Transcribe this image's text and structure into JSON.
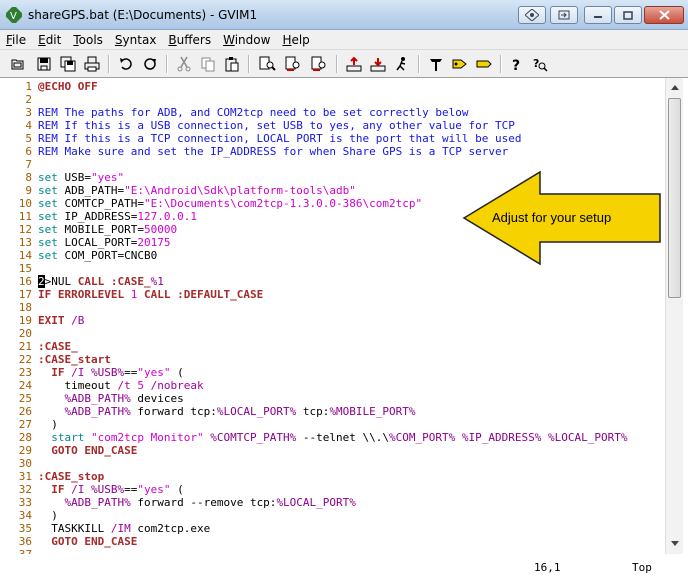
{
  "window": {
    "title": "shareGPS.bat (E:\\Documents) - GVIM1"
  },
  "menu": [
    "File",
    "Edit",
    "Tools",
    "Syntax",
    "Buffers",
    "Window",
    "Help"
  ],
  "toolbar_icons": [
    "open-icon",
    "save-icon",
    "save-all-icon",
    "print-icon",
    "undo-icon",
    "redo-icon",
    "cut-icon",
    "copy-icon",
    "paste-icon",
    "find-replace-icon",
    "find-next-icon",
    "find-prev-icon",
    "load-session-icon",
    "save-session-icon",
    "run-script-icon",
    "make-icon",
    "tag-icon",
    "jump-back-icon",
    "help-icon",
    "find-help-icon"
  ],
  "lines": [
    {
      "n": "1",
      "tokens": [
        {
          "t": "@ECHO",
          "c": "kw"
        },
        {
          "t": " "
        },
        {
          "t": "OFF",
          "c": "kw"
        }
      ]
    },
    {
      "n": "2",
      "tokens": []
    },
    {
      "n": "3",
      "tokens": [
        {
          "t": "REM The paths for ADB, and COM2tcp need to be set correctly below",
          "c": "cm"
        }
      ]
    },
    {
      "n": "4",
      "tokens": [
        {
          "t": "REM If this is a USB connection, set USB to yes, any other value for TCP",
          "c": "cm"
        }
      ]
    },
    {
      "n": "5",
      "tokens": [
        {
          "t": "REM If this is a TCP connection, LOCAL PORT is the port that will be used",
          "c": "cm"
        }
      ]
    },
    {
      "n": "6",
      "tokens": [
        {
          "t": "REM Make sure and set the IP_ADDRESS for when Share GPS is a TCP server",
          "c": "cm"
        }
      ]
    },
    {
      "n": "7",
      "tokens": []
    },
    {
      "n": "8",
      "tokens": [
        {
          "t": "set ",
          "c": "vr"
        },
        {
          "t": "USB="
        },
        {
          "t": "\"yes\"",
          "c": "st"
        }
      ]
    },
    {
      "n": "9",
      "tokens": [
        {
          "t": "set ",
          "c": "vr"
        },
        {
          "t": "ADB_PATH="
        },
        {
          "t": "\"E:\\Android\\Sdk\\platform-tools\\adb\"",
          "c": "st"
        }
      ]
    },
    {
      "n": "10",
      "tokens": [
        {
          "t": "set ",
          "c": "vr"
        },
        {
          "t": "COMTCP_PATH="
        },
        {
          "t": "\"E:\\Documents\\com2tcp-1.3.0.0-386\\com2tcp\"",
          "c": "st"
        }
      ]
    },
    {
      "n": "11",
      "tokens": [
        {
          "t": "set ",
          "c": "vr"
        },
        {
          "t": "IP_ADDRESS="
        },
        {
          "t": "127.0.0.1",
          "c": "nm"
        }
      ]
    },
    {
      "n": "12",
      "tokens": [
        {
          "t": "set ",
          "c": "vr"
        },
        {
          "t": "MOBILE_PORT="
        },
        {
          "t": "50000",
          "c": "nm"
        }
      ]
    },
    {
      "n": "13",
      "tokens": [
        {
          "t": "set ",
          "c": "vr"
        },
        {
          "t": "LOCAL_PORT="
        },
        {
          "t": "20175",
          "c": "nm"
        }
      ]
    },
    {
      "n": "14",
      "tokens": [
        {
          "t": "set ",
          "c": "vr"
        },
        {
          "t": "COM_PORT=CNCB0"
        }
      ]
    },
    {
      "n": "15",
      "tokens": []
    },
    {
      "n": "16",
      "tokens": [
        {
          "t": "2",
          "c": "cursor"
        },
        {
          "t": ">NUL "
        },
        {
          "t": "CALL",
          "c": "kw"
        },
        {
          "t": " "
        },
        {
          "t": ":CASE_",
          "c": "kw"
        },
        {
          "t": "%1",
          "c": "hl"
        }
      ]
    },
    {
      "n": "17",
      "tokens": [
        {
          "t": "IF ERRORLEVEL",
          "c": "kw"
        },
        {
          "t": " "
        },
        {
          "t": "1",
          "c": "nm"
        },
        {
          "t": " "
        },
        {
          "t": "CALL",
          "c": "kw"
        },
        {
          "t": " "
        },
        {
          "t": ":DEFAULT_CASE",
          "c": "kw"
        }
      ]
    },
    {
      "n": "18",
      "tokens": []
    },
    {
      "n": "19",
      "tokens": [
        {
          "t": "EXIT",
          "c": "kw"
        },
        {
          "t": " "
        },
        {
          "t": "/B",
          "c": "op"
        }
      ]
    },
    {
      "n": "20",
      "tokens": []
    },
    {
      "n": "21",
      "tokens": [
        {
          "t": ":CASE_",
          "c": "kw"
        }
      ]
    },
    {
      "n": "22",
      "tokens": [
        {
          "t": ":CASE_start",
          "c": "kw"
        }
      ]
    },
    {
      "n": "23",
      "tokens": [
        {
          "t": "  "
        },
        {
          "t": "IF",
          "c": "kw"
        },
        {
          "t": " "
        },
        {
          "t": "/I",
          "c": "op"
        },
        {
          "t": " "
        },
        {
          "t": "%USB%",
          "c": "hl"
        },
        {
          "t": "=="
        },
        {
          "t": "\"yes\"",
          "c": "st"
        },
        {
          "t": " ("
        }
      ]
    },
    {
      "n": "24",
      "tokens": [
        {
          "t": "    timeout "
        },
        {
          "t": "/t",
          "c": "op"
        },
        {
          "t": " "
        },
        {
          "t": "5",
          "c": "nm"
        },
        {
          "t": " "
        },
        {
          "t": "/nobreak",
          "c": "op"
        }
      ]
    },
    {
      "n": "25",
      "tokens": [
        {
          "t": "    "
        },
        {
          "t": "%ADB_PATH%",
          "c": "hl"
        },
        {
          "t": " devices"
        }
      ]
    },
    {
      "n": "26",
      "tokens": [
        {
          "t": "    "
        },
        {
          "t": "%ADB_PATH%",
          "c": "hl"
        },
        {
          "t": " forward tcp:"
        },
        {
          "t": "%LOCAL_PORT%",
          "c": "hl"
        },
        {
          "t": " tcp:"
        },
        {
          "t": "%MOBILE_PORT%",
          "c": "hl"
        }
      ]
    },
    {
      "n": "27",
      "tokens": [
        {
          "t": "  )"
        }
      ]
    },
    {
      "n": "28",
      "tokens": [
        {
          "t": "  start ",
          "c": "vr"
        },
        {
          "t": "\"com2tcp Monitor\"",
          "c": "st"
        },
        {
          "t": " "
        },
        {
          "t": "%COMTCP_PATH%",
          "c": "hl"
        },
        {
          "t": " --telnet \\\\.\\"
        },
        {
          "t": "%COM_PORT%",
          "c": "hl"
        },
        {
          "t": " "
        },
        {
          "t": "%IP_ADDRESS%",
          "c": "hl"
        },
        {
          "t": " "
        },
        {
          "t": "%LOCAL_PORT%",
          "c": "hl"
        }
      ]
    },
    {
      "n": "29",
      "tokens": [
        {
          "t": "  "
        },
        {
          "t": "GOTO",
          "c": "kw"
        },
        {
          "t": " "
        },
        {
          "t": "END_CASE",
          "c": "kw"
        }
      ]
    },
    {
      "n": "30",
      "tokens": []
    },
    {
      "n": "31",
      "tokens": [
        {
          "t": ":CASE_stop",
          "c": "kw"
        }
      ]
    },
    {
      "n": "32",
      "tokens": [
        {
          "t": "  "
        },
        {
          "t": "IF",
          "c": "kw"
        },
        {
          "t": " "
        },
        {
          "t": "/I",
          "c": "op"
        },
        {
          "t": " "
        },
        {
          "t": "%USB%",
          "c": "hl"
        },
        {
          "t": "=="
        },
        {
          "t": "\"yes\"",
          "c": "st"
        },
        {
          "t": " ("
        }
      ]
    },
    {
      "n": "33",
      "tokens": [
        {
          "t": "    "
        },
        {
          "t": "%ADB_PATH%",
          "c": "hl"
        },
        {
          "t": " forward --remove tcp:"
        },
        {
          "t": "%LOCAL_PORT%",
          "c": "hl"
        }
      ]
    },
    {
      "n": "34",
      "tokens": [
        {
          "t": "  )"
        }
      ]
    },
    {
      "n": "35",
      "tokens": [
        {
          "t": "  TASKKILL "
        },
        {
          "t": "/IM",
          "c": "op"
        },
        {
          "t": " com2tcp.exe"
        }
      ]
    },
    {
      "n": "36",
      "tokens": [
        {
          "t": "  "
        },
        {
          "t": "GOTO",
          "c": "kw"
        },
        {
          "t": " "
        },
        {
          "t": "END_CASE",
          "c": "kw"
        }
      ]
    },
    {
      "n": "37",
      "tokens": []
    }
  ],
  "status": {
    "position": "16,1",
    "scroll": "Top"
  },
  "callout": {
    "text": "Adjust for your setup",
    "fill": "#f5d200"
  }
}
